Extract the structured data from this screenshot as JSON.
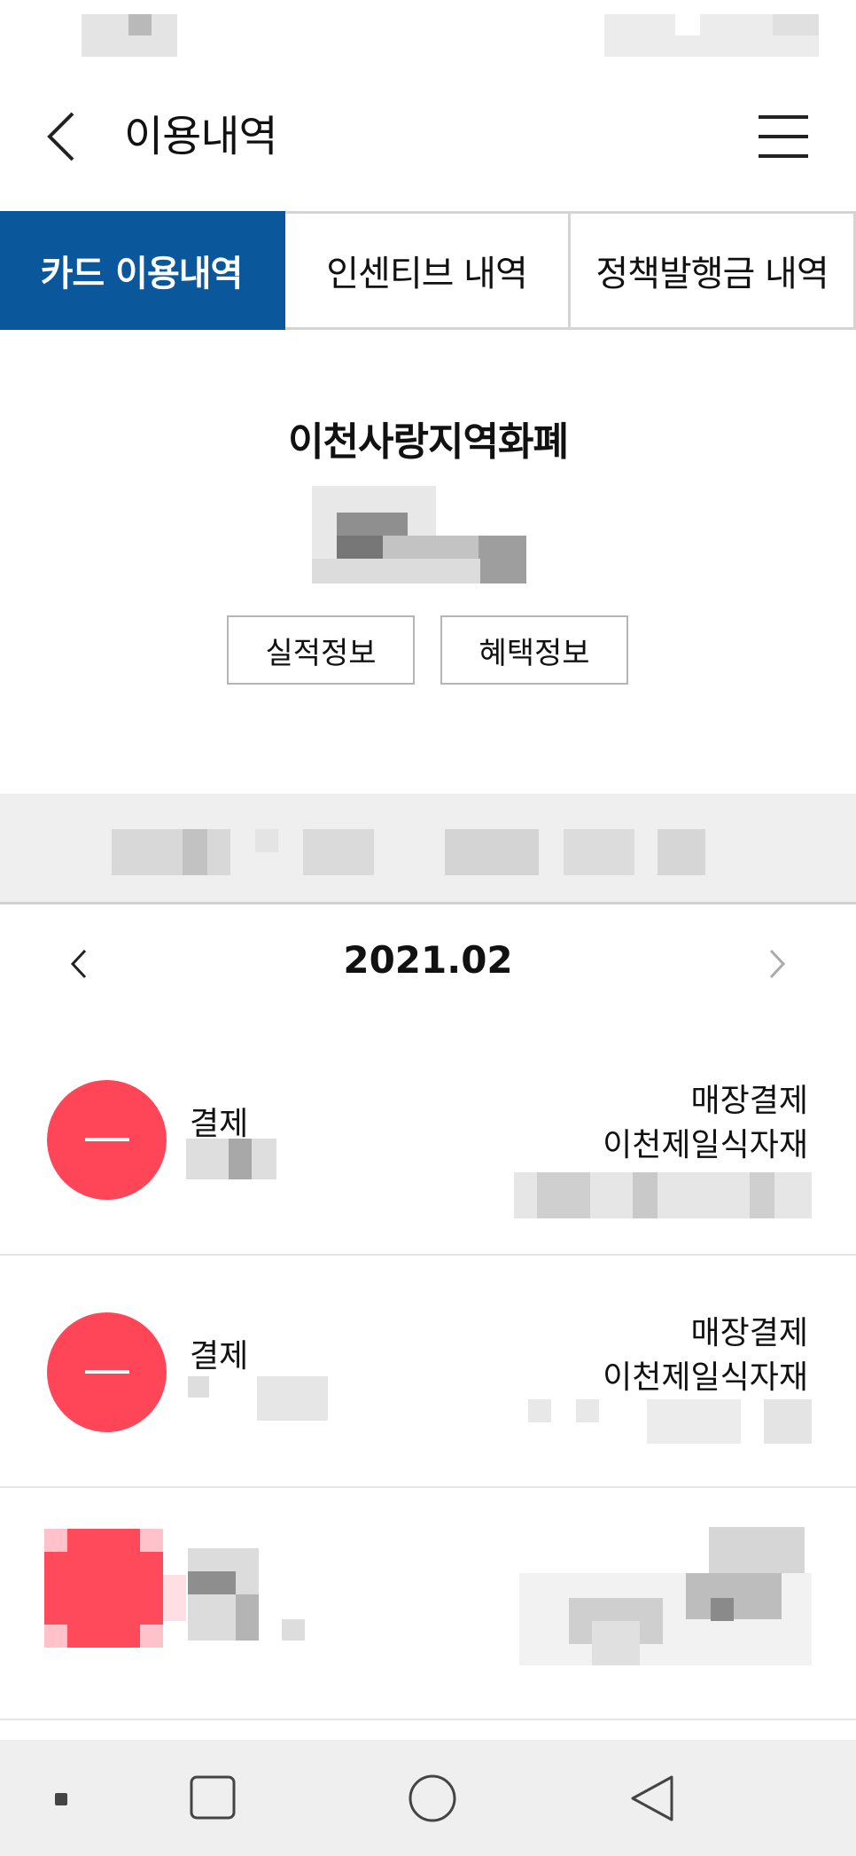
{
  "header": {
    "title": "이용내역",
    "back_icon": "chevron-left-icon",
    "menu_icon": "hamburger-menu-icon"
  },
  "tabs": [
    {
      "label": "카드 이용내역",
      "active": true
    },
    {
      "label": "인센티브 내역",
      "active": false
    },
    {
      "label": "정책발행금 내역",
      "active": false
    }
  ],
  "card": {
    "name": "이천사랑지역화폐",
    "performance_button": "실적정보",
    "benefit_button": "혜택정보"
  },
  "month_nav": {
    "current": "2021.02",
    "prev_icon": "chevron-left-icon",
    "next_icon": "chevron-right-icon"
  },
  "transactions": [
    {
      "type": "결제",
      "method": "매장결제",
      "merchant": "이천제일식자재",
      "icon": "minus-icon"
    },
    {
      "type": "결제",
      "method": "매장결제",
      "merchant": "이천제일식자재",
      "icon": "minus-icon"
    }
  ],
  "colors": {
    "active_tab": "#0b579c",
    "payment_badge": "#ff4558",
    "summary_band": "#efefef",
    "nav_bar": "#efefef"
  }
}
